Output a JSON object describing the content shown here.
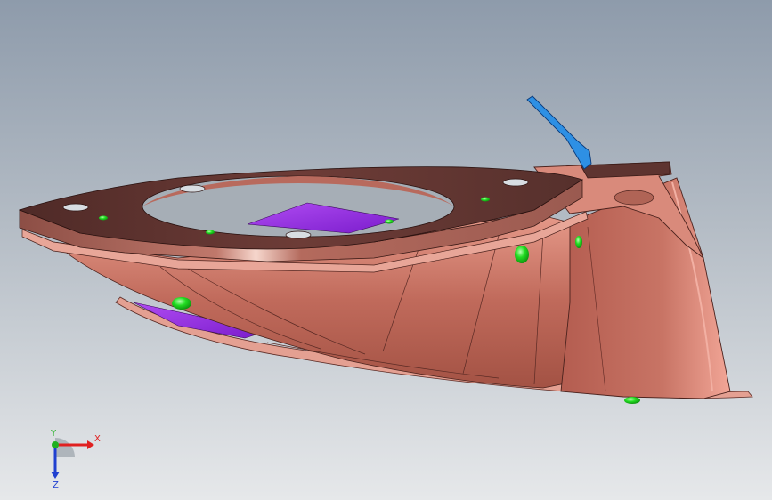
{
  "viewport": {
    "background_top": "#8e9bab",
    "background_bottom": "#e6e8ea"
  },
  "model": {
    "part_color": "#c97566",
    "flange_top_color": "#5e3430",
    "highlight_color": "#f0c0b4",
    "purple_surface_color": "#9b2fe8",
    "blue_tab_color": "#2e90e4",
    "green_marker_color": "#1ed71e"
  },
  "triad": {
    "x_label": "X",
    "y_label": "Y",
    "z_label": "Z",
    "x_color": "#e02020",
    "y_color": "#20b020",
    "z_color": "#2040d0",
    "icon": "coordinate-triad-icon"
  }
}
